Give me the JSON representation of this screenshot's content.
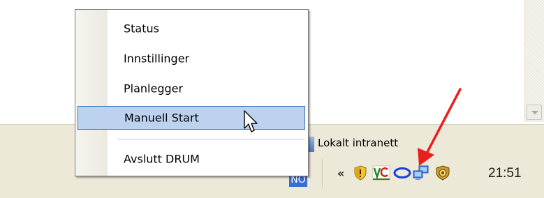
{
  "context_menu": {
    "items": [
      {
        "label": "Status"
      },
      {
        "label": "Innstillinger"
      },
      {
        "label": "Planlegger"
      },
      {
        "label": "Manuell Start",
        "highlighted": true
      },
      {
        "label": "Avslutt DRUM"
      }
    ]
  },
  "statusbar": {
    "zone_label": "Lokalt intranett"
  },
  "taskbar": {
    "language_indicator": "NO",
    "tray": {
      "expand_label": "«",
      "icons": [
        "security-shield-icon",
        "vc-app-icon",
        "drum-ring-icon",
        "network-computers-icon",
        "antivirus-shield-icon"
      ],
      "clock": "21:51"
    }
  },
  "annotation": {
    "arrow_color": "#e8201c"
  },
  "colors": {
    "menu_highlight": "#bcd2ef",
    "menu_highlight_border": "#3574c4",
    "taskbar_bg": "#ece9d8",
    "language_bg": "#3a6cd6"
  }
}
